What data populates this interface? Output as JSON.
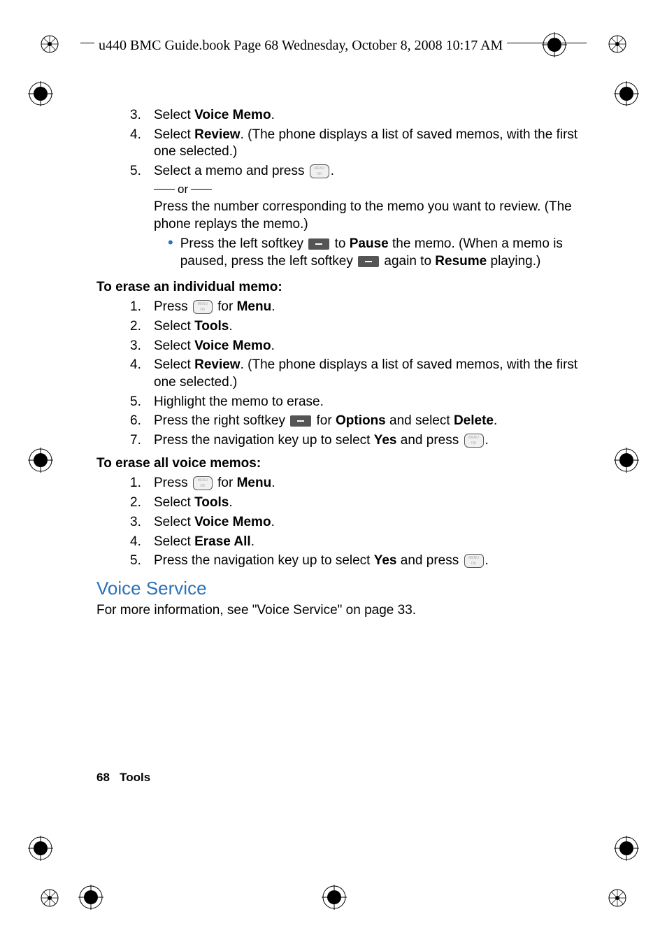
{
  "header": "u440 BMC Guide.book  Page 68  Wednesday, October 8, 2008  10:17 AM",
  "footer": {
    "page": "68",
    "section": "Tools"
  },
  "review_steps": [
    {
      "n": "3.",
      "pre": "Select ",
      "b": "Voice Memo",
      "post": "."
    },
    {
      "n": "4.",
      "pre": "Select ",
      "b": "Review",
      "post": ". (The phone displays a list of saved memos, with the first one selected.)"
    }
  ],
  "step5": {
    "n": "5.",
    "line1_pre": "Select a memo and press ",
    "line1_post": ".",
    "or": "or",
    "line2": "Press the number corresponding to the memo you want to review. (The phone replays the memo.)",
    "bullet_pre": "Press the left softkey ",
    "bullet_mid1": " to ",
    "bullet_b1": "Pause",
    "bullet_mid2": " the memo. (When a memo is paused, press the left softkey ",
    "bullet_mid3": " again to ",
    "bullet_b2": "Resume",
    "bullet_post": " playing.)"
  },
  "erase_individual": {
    "heading": "To erase an individual memo:",
    "steps": {
      "s1": {
        "n": "1.",
        "pre": "Press ",
        "post": " for ",
        "b": "Menu",
        "end": "."
      },
      "s2": {
        "n": "2.",
        "pre": "Select ",
        "b": "Tools",
        "post": "."
      },
      "s3": {
        "n": "3.",
        "pre": "Select ",
        "b": "Voice Memo",
        "post": "."
      },
      "s4": {
        "n": "4.",
        "pre": "Select ",
        "b": "Review",
        "post": ". (The phone displays a list of saved memos, with the first one selected.)"
      },
      "s5": {
        "n": "5.",
        "txt": "Highlight the memo to erase."
      },
      "s6": {
        "n": "6.",
        "pre": "Press the right softkey ",
        "mid": " for ",
        "b1": "Options",
        "mid2": " and select ",
        "b2": "Delete",
        "post": "."
      },
      "s7": {
        "n": "7.",
        "pre": "Press the navigation key up to select ",
        "b": "Yes",
        "mid": " and press ",
        "post": "."
      }
    }
  },
  "erase_all": {
    "heading": "To erase all voice memos:",
    "steps": {
      "s1": {
        "n": "1.",
        "pre": "Press ",
        "post": " for ",
        "b": "Menu",
        "end": "."
      },
      "s2": {
        "n": "2.",
        "pre": "Select ",
        "b": "Tools",
        "post": "."
      },
      "s3": {
        "n": "3.",
        "pre": "Select ",
        "b": "Voice Memo",
        "post": "."
      },
      "s4": {
        "n": "4.",
        "pre": "Select ",
        "b": "Erase All",
        "post": "."
      },
      "s5": {
        "n": "5.",
        "pre": "Press the navigation key up to select ",
        "b": "Yes",
        "mid": " and press ",
        "post": "."
      }
    }
  },
  "voice_service": {
    "title": "Voice Service",
    "text": "For more information, see \"Voice Service\" on page 33."
  }
}
